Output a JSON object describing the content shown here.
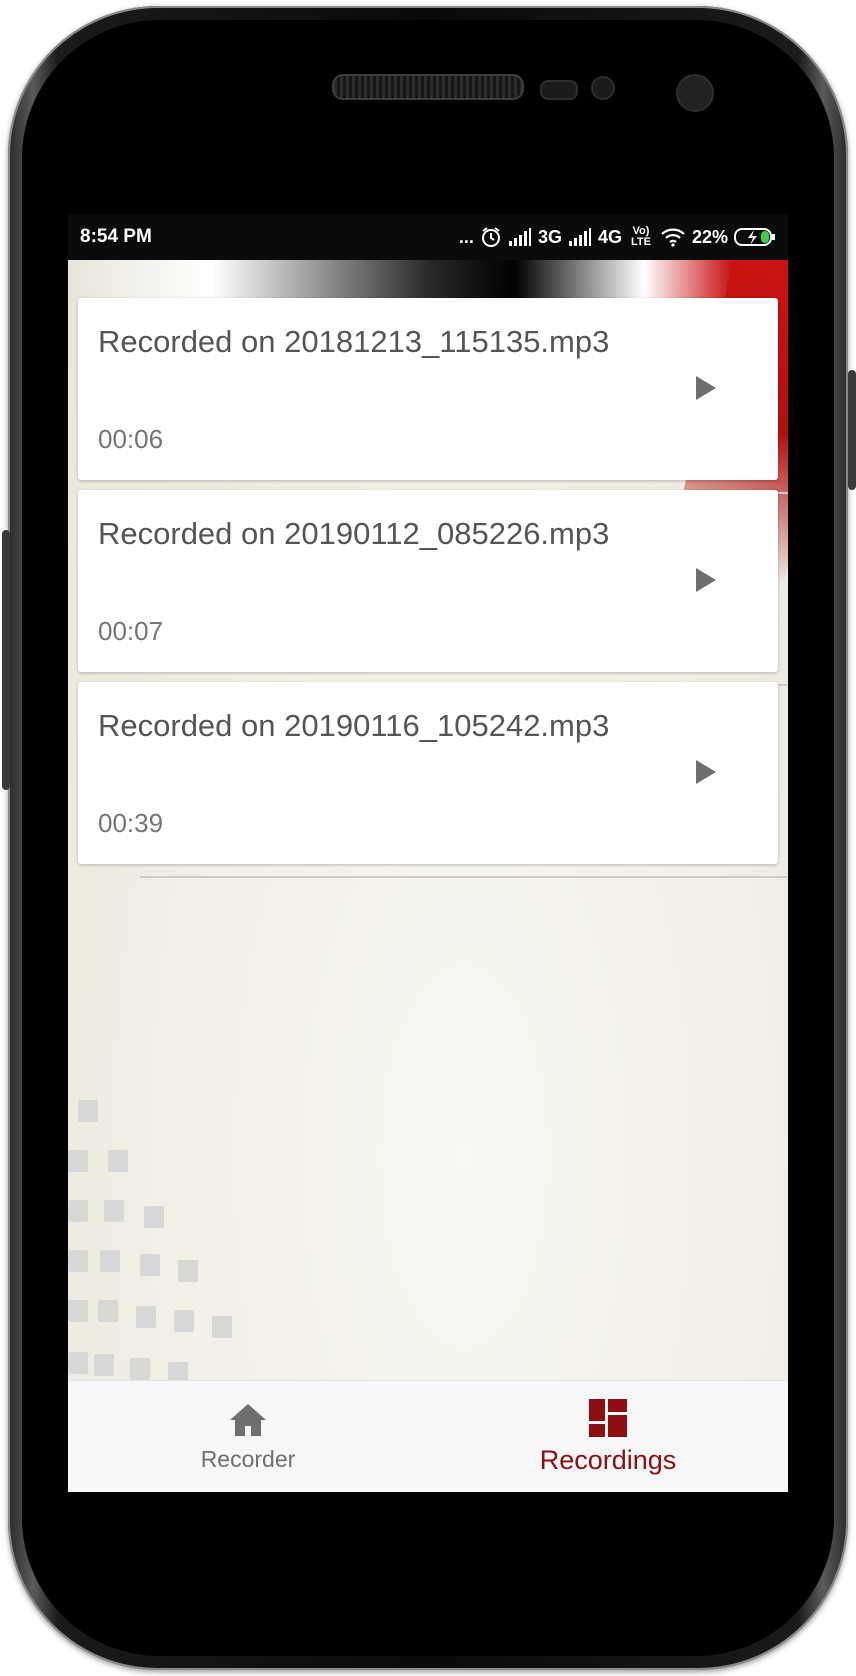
{
  "status_bar": {
    "time": "8:54 PM",
    "more": "...",
    "network_1": "3G",
    "network_2": "4G",
    "volte": "Vo) LTE",
    "battery": "22%"
  },
  "recordings": [
    {
      "title": "Recorded on 20181213_115135.mp3",
      "duration": "00:06"
    },
    {
      "title": "Recorded on 20190112_085226.mp3",
      "duration": "00:07"
    },
    {
      "title": "Recorded on 20190116_105242.mp3",
      "duration": "00:39"
    }
  ],
  "bottom_nav": {
    "items": [
      {
        "label": "Recorder",
        "icon": "home-icon",
        "active": false
      },
      {
        "label": "Recordings",
        "icon": "dashboard-icon",
        "active": true
      }
    ]
  },
  "colors": {
    "accent": "#8e0f12",
    "text_primary": "#555555",
    "text_secondary": "#757575",
    "icon_gray": "#6f6f6f"
  }
}
